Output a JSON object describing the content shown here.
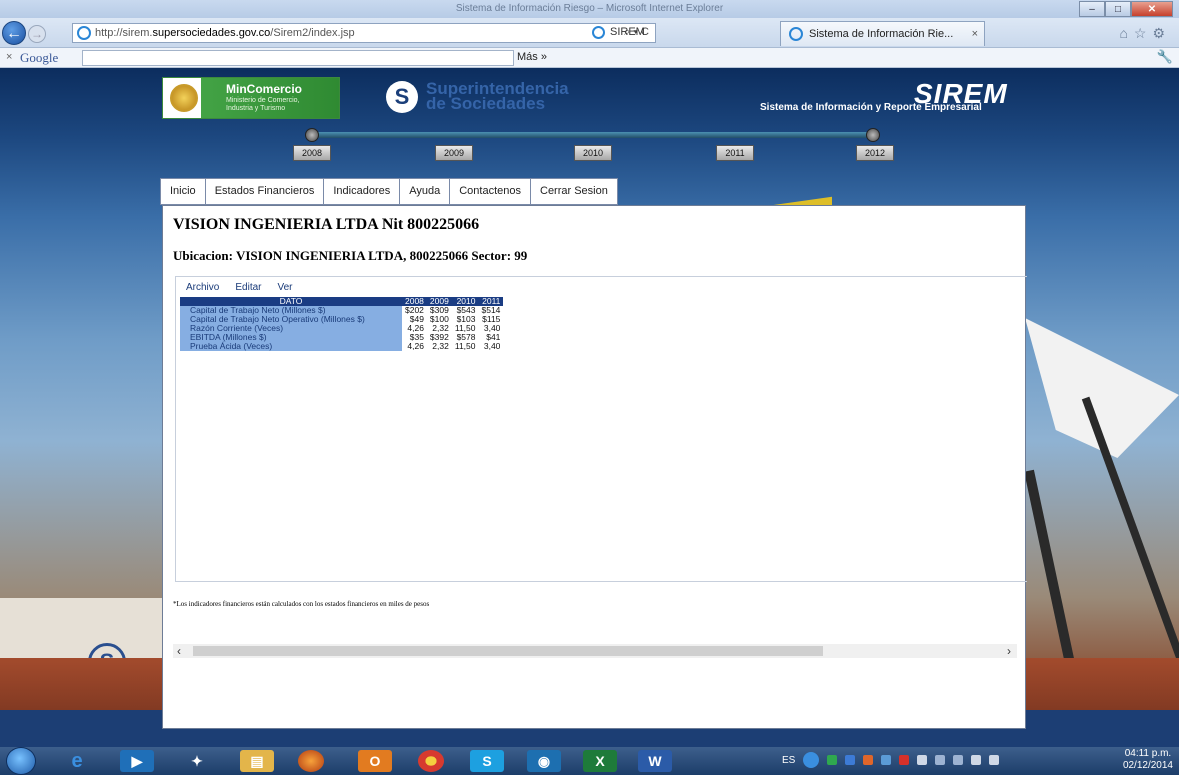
{
  "window": {
    "title": "Sistema de Información Riesgo – Microsoft Internet Explorer"
  },
  "browser": {
    "url_prefix": "http://sirem.",
    "url_domain": "supersociedades.gov.co",
    "url_path": "/Sirem2/index.jsp",
    "addr_tools": "⌕ ▾ C",
    "tab_sirem_label": "SIREM",
    "tab_active_label": "Sistema de Información Rie...",
    "tab_close": "×",
    "google_x": "×",
    "google_logo": "Google",
    "google_more": "Más »",
    "nav_icons": "⌂☆⚙"
  },
  "site": {
    "mincomercio_title": "MinComercio",
    "mincomercio_subtitle": "Ministerio de Comercio, Industria y Turismo",
    "super_line1": "Superintendencia",
    "super_line2": "de Sociedades",
    "sirem_logo": "SIREM",
    "sirem_subtitle": "Sistema de Información y Reporte Empresarial",
    "years": [
      "2008",
      "2009",
      "2010",
      "2011",
      "2012"
    ],
    "menu": [
      "Inicio",
      "Estados Financieros",
      "Indicadores",
      "Ayuda",
      "Contactenos",
      "Cerrar Sesion"
    ]
  },
  "panel": {
    "title": "VISION INGENIERIA LTDA Nit 800225066",
    "ubicacion": "Ubicacion: VISION INGENIERIA LTDA, 800225066 Sector: 99",
    "inner_menu": [
      "Archivo",
      "Editar",
      "Ver"
    ],
    "table": {
      "headers": [
        "DATO",
        "2008",
        "2009",
        "2010",
        "2011"
      ],
      "rows": [
        [
          "Capital de Trabajo Neto (Millones $)",
          "$202",
          "$309",
          "$543",
          "$514"
        ],
        [
          "Capital de Trabajo Neto Operativo (Millones $)",
          "$49",
          "$100",
          "$103",
          "$115"
        ],
        [
          "Razón Corriente (Veces)",
          "4,26",
          "2,32",
          "11,50",
          "3,40"
        ],
        [
          "EBITDA (Millones $)",
          "$35",
          "$392",
          "$578",
          "$41"
        ],
        [
          "Prueba Ácida (Veces)",
          "4,26",
          "2,32",
          "11,50",
          "3,40"
        ]
      ]
    },
    "footnote": "*Los indicadores financieros están calculados con los estados financieros en miles de pesos"
  },
  "taskbar": {
    "lang": "ES",
    "time": "04:11 p.m.",
    "date": "02/12/2014"
  },
  "colors": {
    "table_header": "#1a3c83",
    "table_label": "#86aee2",
    "site_footer": "#1c3e74"
  }
}
